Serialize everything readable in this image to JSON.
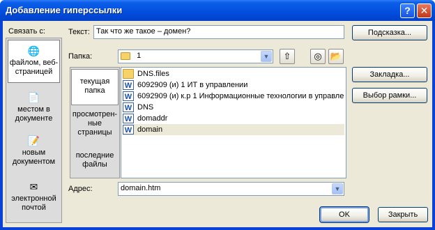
{
  "window": {
    "title": "Добавление гиперссылки",
    "help_glyph": "?",
    "close_glyph": "✕"
  },
  "link_to": {
    "label": "Связать с:",
    "items": [
      {
        "label": "файлом, веб-\nстраницей",
        "icon": "web-page-icon"
      },
      {
        "label": "местом в\nдокументе",
        "icon": "document-place-icon"
      },
      {
        "label": "новым\nдокументом",
        "icon": "new-document-icon"
      },
      {
        "label": "электронной\nпочтой",
        "icon": "email-icon"
      }
    ]
  },
  "text_field": {
    "label": "Текст:",
    "value": "Так что же такое – домен?"
  },
  "hint_button": "Подсказка...",
  "folder": {
    "label": "Папка:",
    "value": "1"
  },
  "browse_nav": {
    "items": [
      {
        "label": "текущая\nпапка"
      },
      {
        "label": "просмотрен-\nные\nстраницы"
      },
      {
        "label": "последние\nфайлы"
      }
    ]
  },
  "files": [
    {
      "name": "DNS.files",
      "icon": "folder-icon"
    },
    {
      "name": "6092909 (и) 1 ИТ в управлении",
      "icon": "word-document-icon"
    },
    {
      "name": "6092909 (и) к.р 1 Информационные технологии в управле",
      "icon": "word-document-icon"
    },
    {
      "name": "DNS",
      "icon": "word-document-icon"
    },
    {
      "name": "domaddr",
      "icon": "word-document-icon"
    },
    {
      "name": "domain",
      "icon": "word-document-icon"
    }
  ],
  "bookmark_button": "Закладка...",
  "frame_button": "Выбор рамки...",
  "address": {
    "label": "Адрес:",
    "value": "domain.htm"
  },
  "ok_button": "OK",
  "close_button": "Закрыть"
}
